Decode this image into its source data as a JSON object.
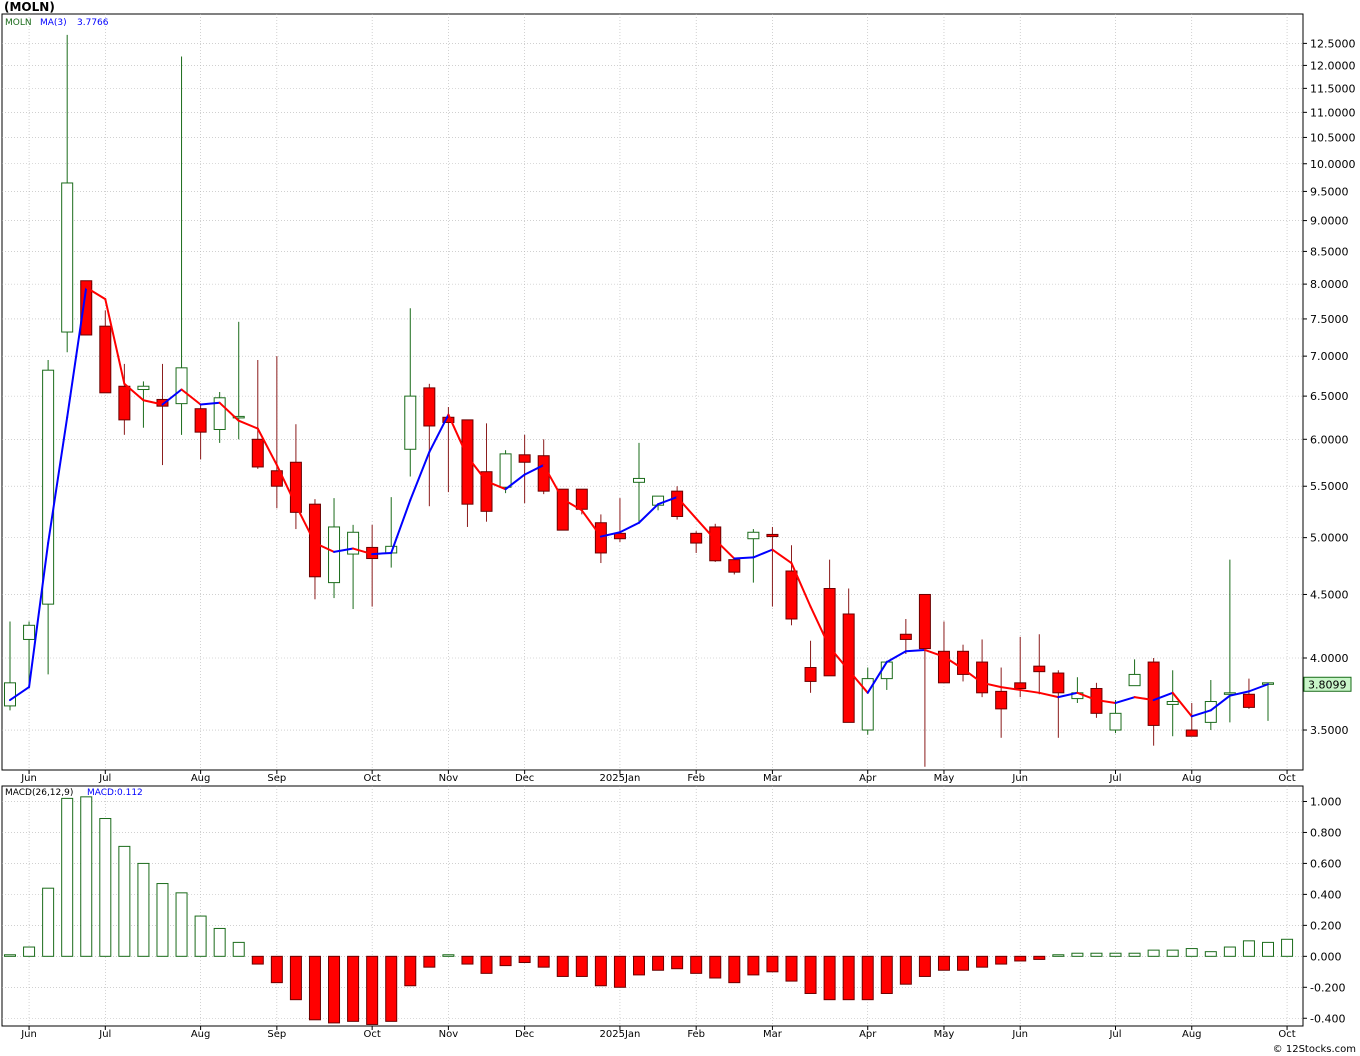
{
  "title": "(MOLN)",
  "footer": "© 12Stocks.com",
  "colors": {
    "up": "#1a6b1a",
    "down": "#ff0000",
    "ma_up": "#0000ff",
    "ma_down": "#ff0000",
    "last_price_bg": "#c8f5c8",
    "grid": "#b4b4b4"
  },
  "chart_data": [
    {
      "type": "candlestick",
      "symbol": "MOLN",
      "legend": {
        "symbol": "MOLN",
        "ma_label": "MA(3)",
        "ma_value": "3.7766"
      },
      "last_price": "3.8099",
      "y_scale": "log",
      "ylim": [
        3.25,
        13.2
      ],
      "y_ticks": [
        "3.5000",
        "4.0000",
        "4.5000",
        "5.0000",
        "5.5000",
        "6.0000",
        "6.5000",
        "7.0000",
        "7.5000",
        "8.0000",
        "8.5000",
        "9.0000",
        "9.5000",
        "10.0000",
        "10.5000",
        "11.0000",
        "11.5000",
        "12.0000",
        "12.5000"
      ],
      "x_labels": [
        "Jun",
        "Jul",
        "Aug",
        "Sep",
        "Oct",
        "Nov",
        "Dec",
        "2025Jan",
        "Feb",
        "Mar",
        "Apr",
        "May",
        "Jun",
        "Jul",
        "Aug",
        "Oct"
      ],
      "ohlc": [
        [
          3.63,
          4.28,
          3.66,
          3.82
        ],
        [
          3.78,
          4.28,
          4.14,
          4.25
        ],
        [
          3.88,
          6.95,
          4.42,
          6.82
        ],
        [
          7.05,
          12.7,
          7.32,
          9.65
        ],
        [
          7.8,
          8.05,
          8.05,
          7.28
        ],
        [
          6.85,
          7.62,
          7.4,
          6.54
        ],
        [
          6.05,
          6.9,
          6.62,
          6.22
        ],
        [
          6.13,
          6.68,
          6.58,
          6.62
        ],
        [
          5.72,
          6.9,
          6.46,
          6.38
        ],
        [
          6.05,
          12.2,
          6.41,
          6.85
        ],
        [
          5.78,
          6.4,
          6.35,
          6.08
        ],
        [
          5.96,
          6.55,
          6.11,
          6.48
        ],
        [
          6.0,
          7.46,
          6.26,
          6.26
        ],
        [
          5.68,
          6.95,
          6.0,
          5.7
        ],
        [
          5.28,
          7.0,
          5.66,
          5.5
        ],
        [
          5.08,
          6.17,
          5.75,
          5.24
        ],
        [
          4.46,
          5.37,
          5.32,
          4.65
        ],
        [
          4.47,
          5.38,
          4.6,
          5.1
        ],
        [
          4.38,
          5.12,
          4.85,
          5.05
        ],
        [
          4.4,
          5.12,
          4.91,
          4.81
        ],
        [
          4.73,
          5.39,
          4.86,
          4.92
        ],
        [
          5.6,
          7.65,
          5.89,
          6.5
        ],
        [
          5.3,
          6.65,
          6.6,
          6.15
        ],
        [
          5.44,
          6.37,
          6.25,
          6.19
        ],
        [
          5.1,
          6.2,
          6.22,
          5.32
        ],
        [
          5.15,
          6.18,
          5.65,
          5.25
        ],
        [
          5.43,
          5.88,
          5.49,
          5.84
        ],
        [
          5.33,
          6.05,
          5.83,
          5.75
        ],
        [
          5.42,
          6.0,
          5.82,
          5.45
        ],
        [
          5.07,
          5.46,
          5.47,
          5.07
        ],
        [
          5.22,
          5.47,
          5.47,
          5.27
        ],
        [
          4.77,
          5.22,
          5.14,
          4.86
        ],
        [
          4.96,
          5.38,
          5.04,
          4.99
        ],
        [
          5.13,
          5.96,
          5.54,
          5.58
        ],
        [
          5.26,
          5.4,
          5.31,
          5.4
        ],
        [
          5.17,
          5.5,
          5.45,
          5.2
        ],
        [
          4.86,
          5.06,
          5.04,
          4.95
        ],
        [
          4.78,
          5.13,
          5.1,
          4.79
        ],
        [
          4.67,
          4.8,
          4.8,
          4.69
        ],
        [
          4.6,
          5.08,
          4.99,
          5.05
        ],
        [
          4.4,
          5.1,
          5.03,
          5.01
        ],
        [
          4.25,
          4.93,
          4.7,
          4.3
        ],
        [
          3.75,
          4.13,
          3.93,
          3.83
        ],
        [
          3.88,
          4.8,
          4.55,
          3.87
        ],
        [
          3.55,
          4.55,
          4.34,
          3.55
        ],
        [
          3.47,
          3.93,
          3.5,
          3.85
        ],
        [
          3.77,
          3.98,
          3.85,
          3.97
        ],
        [
          4.03,
          4.3,
          4.18,
          4.14
        ],
        [
          3.27,
          4.15,
          4.5,
          4.07
        ],
        [
          3.82,
          4.28,
          4.05,
          3.82
        ],
        [
          3.83,
          4.1,
          4.05,
          3.88
        ],
        [
          3.72,
          4.14,
          3.97,
          3.75
        ],
        [
          3.45,
          3.93,
          3.76,
          3.64
        ],
        [
          3.72,
          4.16,
          3.82,
          3.78
        ],
        [
          3.74,
          4.18,
          3.94,
          3.9
        ],
        [
          3.45,
          3.91,
          3.89,
          3.75
        ],
        [
          3.68,
          3.86,
          3.71,
          3.75
        ],
        [
          3.58,
          3.82,
          3.78,
          3.61
        ],
        [
          3.48,
          3.7,
          3.5,
          3.61
        ],
        [
          3.8,
          3.99,
          3.8,
          3.88
        ],
        [
          3.4,
          4.0,
          3.97,
          3.53
        ],
        [
          3.46,
          3.91,
          3.67,
          3.69
        ],
        [
          3.46,
          3.68,
          3.5,
          3.46
        ],
        [
          3.5,
          3.84,
          3.55,
          3.69
        ],
        [
          3.55,
          4.8,
          3.75,
          3.75
        ],
        [
          3.64,
          3.85,
          3.74,
          3.65
        ],
        [
          3.56,
          3.81,
          3.81,
          3.82
        ]
      ],
      "ma3": [
        3.7,
        3.79,
        4.95,
        6.25,
        7.95,
        7.78,
        6.65,
        6.45,
        6.4,
        6.58,
        6.4,
        6.42,
        6.21,
        6.12,
        5.72,
        5.31,
        4.95,
        4.87,
        4.9,
        4.85,
        4.86,
        5.36,
        5.86,
        6.28,
        5.81,
        5.55,
        5.47,
        5.62,
        5.72,
        5.37,
        5.26,
        5.01,
        5.05,
        5.14,
        5.32,
        5.39,
        5.18,
        4.98,
        4.81,
        4.82,
        4.89,
        4.77,
        4.4,
        4.08,
        3.91,
        3.75,
        3.97,
        4.05,
        4.06,
        4.01,
        3.92,
        3.82,
        3.79,
        3.77,
        3.75,
        3.72,
        3.75,
        3.7,
        3.68,
        3.72,
        3.7,
        3.75,
        3.59,
        3.63,
        3.73,
        3.76,
        3.81
      ]
    },
    {
      "type": "bar",
      "indicator": "MACD",
      "legend": {
        "label": "MACD(26,12,9)",
        "value_label": "MACD:0.112"
      },
      "ylim": [
        -0.45,
        1.1
      ],
      "y_ticks": [
        "1.000",
        "0.800",
        "0.600",
        "0.400",
        "0.200",
        "0.000",
        "-0.200",
        "-0.400"
      ],
      "x_labels": [
        "Jun",
        "Jul",
        "Aug",
        "Sep",
        "Oct",
        "Nov",
        "Dec",
        "2025Jan",
        "Feb",
        "Mar",
        "Apr",
        "May",
        "Jun",
        "Jul",
        "Aug",
        "Oct"
      ],
      "values": [
        0.01,
        0.06,
        0.44,
        1.02,
        1.03,
        0.89,
        0.71,
        0.6,
        0.47,
        0.41,
        0.26,
        0.18,
        0.09,
        -0.05,
        -0.17,
        -0.28,
        -0.41,
        -0.43,
        -0.42,
        -0.44,
        -0.42,
        -0.19,
        -0.07,
        0.01,
        -0.05,
        -0.11,
        -0.06,
        -0.04,
        -0.07,
        -0.13,
        -0.13,
        -0.19,
        -0.2,
        -0.12,
        -0.09,
        -0.08,
        -0.11,
        -0.14,
        -0.17,
        -0.12,
        -0.1,
        -0.16,
        -0.24,
        -0.28,
        -0.28,
        -0.28,
        -0.24,
        -0.18,
        -0.13,
        -0.09,
        -0.09,
        -0.07,
        -0.05,
        -0.03,
        -0.02,
        0.01,
        0.02,
        0.02,
        0.02,
        0.02,
        0.04,
        0.04,
        0.05,
        0.03,
        0.06,
        0.1,
        0.09,
        0.11
      ]
    }
  ]
}
